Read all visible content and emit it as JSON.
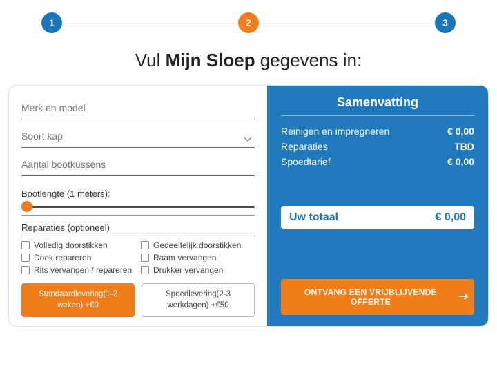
{
  "stepper": {
    "steps": [
      "1",
      "2",
      "3"
    ],
    "active_index": 1
  },
  "title": {
    "prefix": "Vul ",
    "bold": "Mijn Sloep",
    "suffix": " gegevens in:"
  },
  "form": {
    "brand_placeholder": "Merk en model",
    "hood_placeholder": "Soort kap",
    "cushions_placeholder": "Aantal bootkussens",
    "length_label": "Bootlengte (1 meters):",
    "repairs_title": "Reparaties (optioneel)",
    "repairs": [
      "Volledig doorstikken",
      "Gedeeltelijk doorstikken",
      "Doek repareren",
      "Raam vervangen",
      "Rits vervangen / repareren",
      "Drukker vervangen"
    ],
    "delivery_standard": "Standaardlevering(1-2 weken) +€0",
    "delivery_rush": "Spoedlevering(2-3 werkdagen) +€50"
  },
  "summary": {
    "title": "Samenvatting",
    "rows": [
      {
        "label": "Reinigen en impregneren",
        "value": "€ 0,00"
      },
      {
        "label": "Reparaties",
        "value": "TBD"
      },
      {
        "label": "Spoedtarief",
        "value": "€ 0,00"
      }
    ],
    "total_label": "Uw totaal",
    "total_value": "€ 0,00",
    "cta": "ONTVANG EEN VRIJBLIJVENDE OFFERTE"
  }
}
